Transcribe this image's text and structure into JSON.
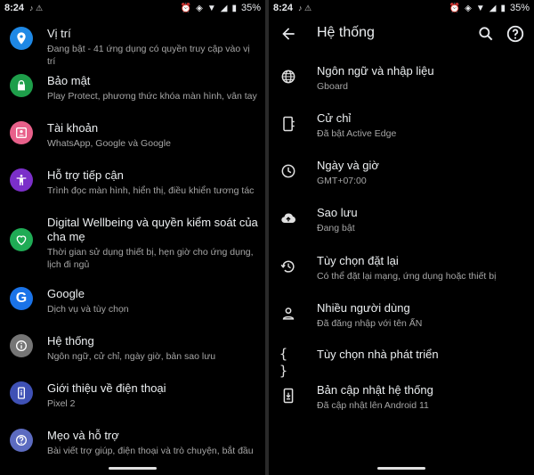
{
  "left": {
    "status": {
      "time": "8:24",
      "notif": "♪  ⚠",
      "battery": "35%"
    },
    "items": [
      {
        "title": "Vị trí",
        "subtitle": "Đang bật - 41 ứng dụng có quyền truy cập vào vị trí",
        "color": "#1e88e5",
        "icon": "location-icon"
      },
      {
        "title": "Bảo mật",
        "subtitle": "Play Protect, phương thức khóa màn hình, vân tay",
        "color": "#1e9e4a",
        "icon": "lock-icon"
      },
      {
        "title": "Tài khoản",
        "subtitle": "WhatsApp, Google và Google",
        "color": "#e8608a",
        "icon": "account-icon"
      },
      {
        "title": "Hỗ trợ tiếp cận",
        "subtitle": "Trình đọc màn hình, hiển thị, điều khiển tương tác",
        "color": "#7b2fc9",
        "icon": "accessibility-icon"
      },
      {
        "title": "Digital Wellbeing và quyền kiểm soát của cha mẹ",
        "subtitle": "Thời gian sử dụng thiết bị, hẹn giờ cho ứng dụng, lịch đi ngủ",
        "color": "#1fab55",
        "icon": "wellbeing-icon"
      },
      {
        "title": "Google",
        "subtitle": "Dịch vụ và tùy chọn",
        "color": "#1a73e8",
        "icon": "google-icon"
      },
      {
        "title": "Hệ thống",
        "subtitle": "Ngôn ngữ, cử chỉ, ngày giờ, bản sao lưu",
        "color": "#757575",
        "icon": "info-icon"
      },
      {
        "title": "Giới thiệu về điện thoại",
        "subtitle": "Pixel 2",
        "color": "#3f51b5",
        "icon": "phone-icon"
      },
      {
        "title": "Mẹo và hỗ trợ",
        "subtitle": "Bài viết trợ giúp, điện thoại và trò chuyện, bắt đầu",
        "color": "#5c6bc0",
        "icon": "help-icon"
      }
    ]
  },
  "right": {
    "status": {
      "time": "8:24",
      "notif": "♪  ⚠",
      "battery": "35%"
    },
    "title": "Hệ thống",
    "items": [
      {
        "title": "Ngôn ngữ và nhập liệu",
        "subtitle": "Gboard",
        "icon": "globe-icon"
      },
      {
        "title": "Cử chỉ",
        "subtitle": "Đã bật Active Edge",
        "icon": "gesture-phone-icon"
      },
      {
        "title": "Ngày và giờ",
        "subtitle": "GMT+07:00",
        "icon": "clock-icon"
      },
      {
        "title": "Sao lưu",
        "subtitle": "Đang bật",
        "icon": "cloud-upload-icon"
      },
      {
        "title": "Tùy chọn đặt lại",
        "subtitle": "Có thể đặt lại mạng, ứng dụng hoặc thiết bị",
        "icon": "history-icon"
      },
      {
        "title": "Nhiều người dùng",
        "subtitle": "Đã đăng nhập với tên ẤN",
        "icon": "person-icon"
      },
      {
        "title": "Tùy chọn nhà phát triển",
        "subtitle": "",
        "icon": "braces-icon"
      },
      {
        "title": "Bản cập nhật hệ thống",
        "subtitle": "Đã cập nhật lên Android 11",
        "icon": "system-update-icon"
      }
    ]
  }
}
